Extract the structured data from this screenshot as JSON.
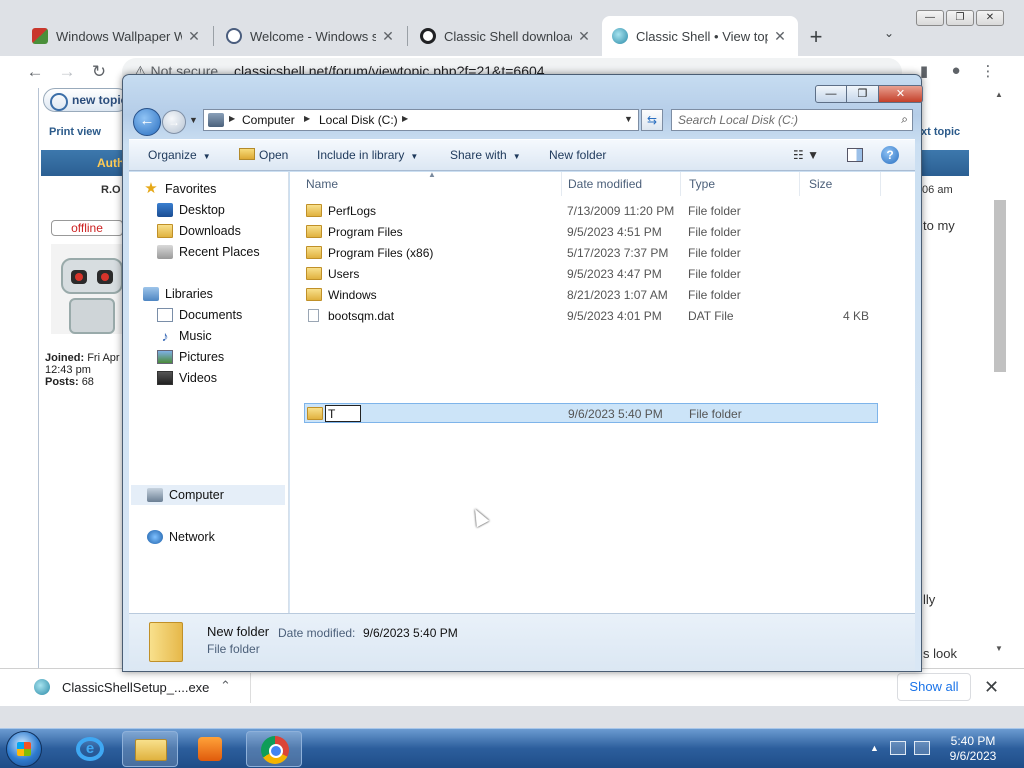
{
  "browser": {
    "tabs": [
      {
        "title": "Windows Wallpaper Wik"
      },
      {
        "title": "Welcome - Windows so"
      },
      {
        "title": "Classic Shell download"
      },
      {
        "title": "Classic Shell • View topi"
      }
    ],
    "new_tab_symbol": "+",
    "tab_close_symbol": "✕",
    "url_prefix": "Not secure",
    "url": "classicshell.net/forum/viewtopic.php?f=21&t=6604"
  },
  "webpage": {
    "newtopic_label": "new topic",
    "print_view": "Print view",
    "next_topic": "xt topic",
    "author_header": "Auth",
    "poster_name": "R.O",
    "post_time": ":06 am",
    "status_badge": "offline",
    "joined_label": "Joined:",
    "joined_value": "Fri Apr",
    "joined_time": "12:43 pm",
    "posts_label": "Posts:",
    "posts_value": "68",
    "text_fragments": [
      "to my",
      "lly",
      "s look"
    ]
  },
  "explorer": {
    "address": {
      "segments": [
        "Computer",
        "Local Disk (C:)"
      ]
    },
    "search_placeholder": "Search Local Disk (C:)",
    "commands": {
      "organize": "Organize",
      "open": "Open",
      "include_in_library": "Include in library",
      "share_with": "Share with",
      "new_folder": "New folder"
    },
    "nav": {
      "favorites": "Favorites",
      "desktop": "Desktop",
      "downloads": "Downloads",
      "recent_places": "Recent Places",
      "libraries": "Libraries",
      "documents": "Documents",
      "music": "Music",
      "pictures": "Pictures",
      "videos": "Videos",
      "computer": "Computer",
      "network": "Network"
    },
    "columns": {
      "name": "Name",
      "date_modified": "Date modified",
      "type": "Type",
      "size": "Size"
    },
    "files": [
      {
        "name": "PerfLogs",
        "date": "7/13/2009 11:20 PM",
        "type": "File folder",
        "size": "",
        "kind": "folder"
      },
      {
        "name": "Program Files",
        "date": "9/5/2023 4:51 PM",
        "type": "File folder",
        "size": "",
        "kind": "folder"
      },
      {
        "name": "Program Files (x86)",
        "date": "5/17/2023 7:37 PM",
        "type": "File folder",
        "size": "",
        "kind": "folder"
      },
      {
        "name": "Users",
        "date": "9/5/2023 4:47 PM",
        "type": "File folder",
        "size": "",
        "kind": "folder"
      },
      {
        "name": "Windows",
        "date": "8/21/2023 1:07 AM",
        "type": "File folder",
        "size": "",
        "kind": "folder"
      },
      {
        "name": "bootsqm.dat",
        "date": "9/5/2023 4:01 PM",
        "type": "DAT File",
        "size": "4 KB",
        "kind": "file"
      }
    ],
    "renaming_row": {
      "value": "T",
      "date": "9/6/2023 5:40 PM",
      "type": "File folder"
    },
    "details": {
      "name": "New folder",
      "date_label": "Date modified:",
      "date_value": "9/6/2023 5:40 PM",
      "type": "File folder"
    }
  },
  "downloads": {
    "filename": "ClassicShellSetup_....exe",
    "show_all": "Show all",
    "close_symbol": "✕"
  },
  "taskbar": {
    "time": "5:40 PM",
    "date": "9/6/2023"
  }
}
